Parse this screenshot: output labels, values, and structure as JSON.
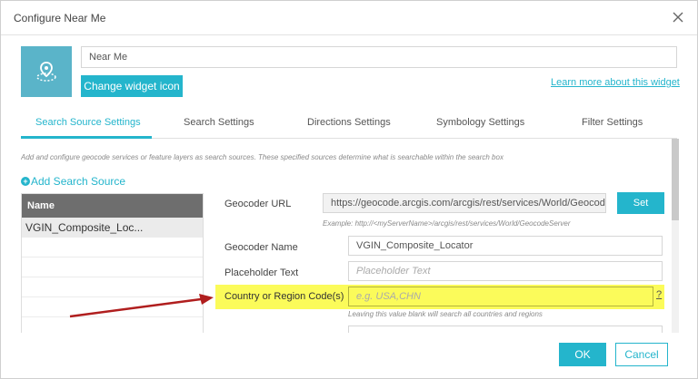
{
  "dialog": {
    "title": "Configure Near Me",
    "close_icon": "close-icon"
  },
  "widget": {
    "name_value": "Near Me",
    "change_icon_label": "Change widget icon",
    "learn_more_label": "Learn more about this widget",
    "icon": "location-pin-icon"
  },
  "tabs": [
    {
      "label": "Search Source Settings",
      "active": true
    },
    {
      "label": "Search Settings",
      "active": false
    },
    {
      "label": "Directions Settings",
      "active": false
    },
    {
      "label": "Symbology Settings",
      "active": false
    },
    {
      "label": "Filter Settings",
      "active": false
    }
  ],
  "search_source": {
    "description": "Add and configure geocode services or feature layers as search sources. These specified sources determine what is searchable within the search box",
    "add_label": "Add Search Source",
    "table_header": "Name",
    "rows": [
      "VGIN_Composite_Loc..."
    ]
  },
  "form": {
    "geocoder_url_label": "Geocoder URL",
    "geocoder_url_value": "https://geocode.arcgis.com/arcgis/rest/services/World/GeocodeServer",
    "set_label": "Set",
    "url_example": "Example: http://<myServerName>/arcgis/rest/services/World/GeocodeServer",
    "geocoder_name_label": "Geocoder Name",
    "geocoder_name_value": "VGIN_Composite_Locator",
    "placeholder_label": "Placeholder Text",
    "placeholder_placeholder": "Placeholder Text",
    "country_label": "Country or Region Code(s)",
    "country_placeholder": "e.g. USA,CHN",
    "help_label": "?",
    "country_hint": "Leaving this value blank will search all countries and regions"
  },
  "footer": {
    "ok_label": "OK",
    "cancel_label": "Cancel"
  },
  "colors": {
    "accent": "#24b5cc",
    "highlight": "#fbfb5a",
    "arrow": "#b01e1e"
  }
}
